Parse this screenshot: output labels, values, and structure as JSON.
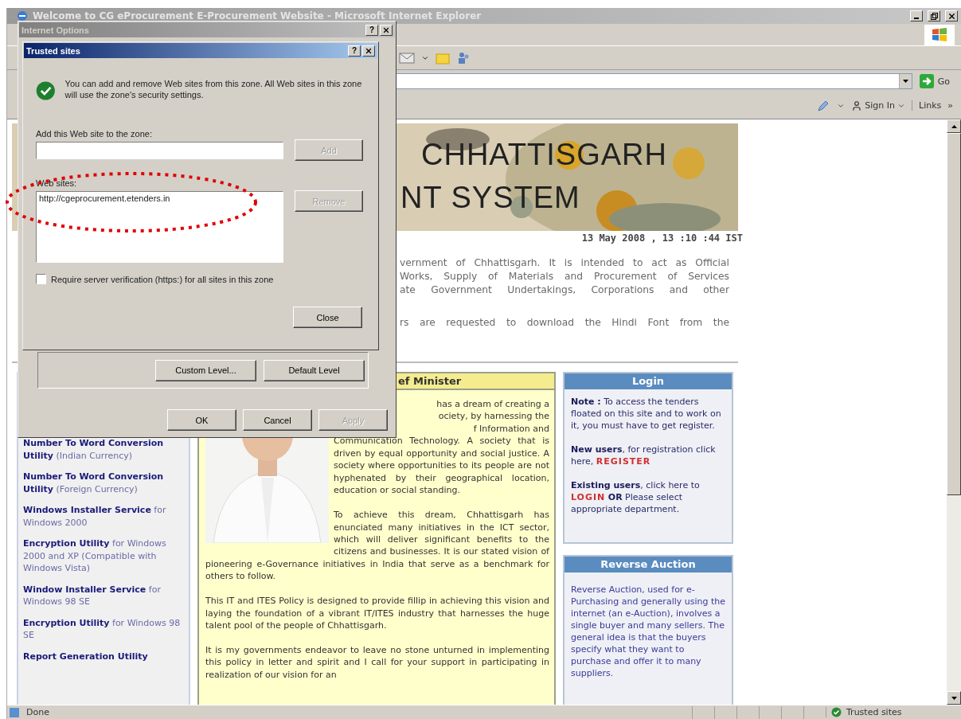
{
  "browser": {
    "title": "Welcome to CG eProcurement E-Procurement Website - Microsoft Internet Explorer",
    "go_label": "Go",
    "sign_in": "Sign In",
    "links": "Links",
    "links_more": "»"
  },
  "page": {
    "banner_lines": [
      "CHHATTISGARH",
      "NT SYSTEM"
    ],
    "datetime": "13 May 2008 , 13 :10 :44 IST",
    "intro_lines": [
      "vernment of Chhattisgarh. It is intended to act as Official",
      "Works, Supply of Materials and Procurement of Services",
      "ate Government Undertakings, Corporations and other"
    ],
    "notice_line": "rs are requested to download the Hindi Font from the",
    "sidebar_items": [
      "**Number To Word Conversion Utility** (Indian Currency)",
      "**Number To Word Conversion Utility** (Foreign Currency)",
      "**Windows Installer Service** for Windows 2000",
      "**Encryption Utility** for Windows 2000 and XP (Compatible with Windows Vista)",
      "**Window Installer Service** for Windows 98 SE",
      "**Encryption Utility** for Windows 98 SE",
      "**Report Generation Utility**"
    ],
    "minister": {
      "title": "ef Minister",
      "partial_lines": [
        "has a dream of creating a",
        "ociety, by harnessing the",
        "f Information and"
      ],
      "paragraphs": [
        "Communication Technology. A society that is driven by equal opportunity and social justice. A society where opportunities to its people are not hyphenated by their geographical location, education or social standing.",
        "To achieve this dream, Chhattisgarh has enunciated many initiatives in the ICT sector, which will deliver significant benefits to the citizens and businesses. It is our stated vision of pioneering e-Governance initiatives in India that serve as a benchmark for others to follow.",
        "This IT and ITES Policy is designed to provide fillip in achieving this vision and laying the foundation of a vibrant IT/ITES industry that harnesses the huge talent pool of the people of Chhattisgarh.",
        "It is my governments endeavor to leave no stone unturned in implementing this policy in letter and spirit and I call for your support in participating in realization of our vision for an"
      ]
    },
    "login": {
      "title": "Login",
      "paragraphs": [
        [
          {
            "kind": "text",
            "text": "**Note :** To access the tenders floated on this site and to work on it, you must have to get register."
          }
        ],
        [
          {
            "kind": "text",
            "text": "**New users**, for registration click here, "
          },
          {
            "kind": "link",
            "text": "REGISTER"
          }
        ],
        [
          {
            "kind": "text",
            "text": "**Existing users**, click here to "
          },
          {
            "kind": "link",
            "text": "LOGIN"
          },
          {
            "kind": "text",
            "text": " **OR** Please select appropriate department."
          }
        ]
      ]
    },
    "reverse_auction": {
      "title": "Reverse Auction",
      "text": "Reverse Auction, used for e-Purchasing and generally using the internet (an e-Auction), involves a single buyer and many sellers. The general idea is that the buyers specify what they want to purchase and offer it to many suppliers."
    }
  },
  "status_bar": {
    "text": "Done",
    "zone": "Trusted sites"
  },
  "internet_options": {
    "title": "Internet Options",
    "help": "?",
    "level_buttons": [
      {
        "label": "Custom Level..."
      },
      {
        "label": "Default Level"
      }
    ],
    "footer_buttons": [
      {
        "label": "OK",
        "disabled": false
      },
      {
        "label": "Cancel",
        "disabled": false
      },
      {
        "label": "Apply",
        "disabled": true
      }
    ]
  },
  "trusted_sites": {
    "title": "Trusted sites",
    "help": "?",
    "description": "You can add and remove Web sites from this zone. All Web sites in this zone will use the zone's security settings.",
    "add_label": "Add this Web site to the zone:",
    "add_button": {
      "label": "Add",
      "disabled": true
    },
    "list_label": "Web sites:",
    "sites": [
      "http://cgeprocurement.etenders.in"
    ],
    "remove_button": {
      "label": "Remove",
      "disabled": true
    },
    "require_https": {
      "label": "Require server verification (https:) for all sites in this zone",
      "checked": false
    },
    "close_button": {
      "label": "Close",
      "disabled": false
    }
  }
}
